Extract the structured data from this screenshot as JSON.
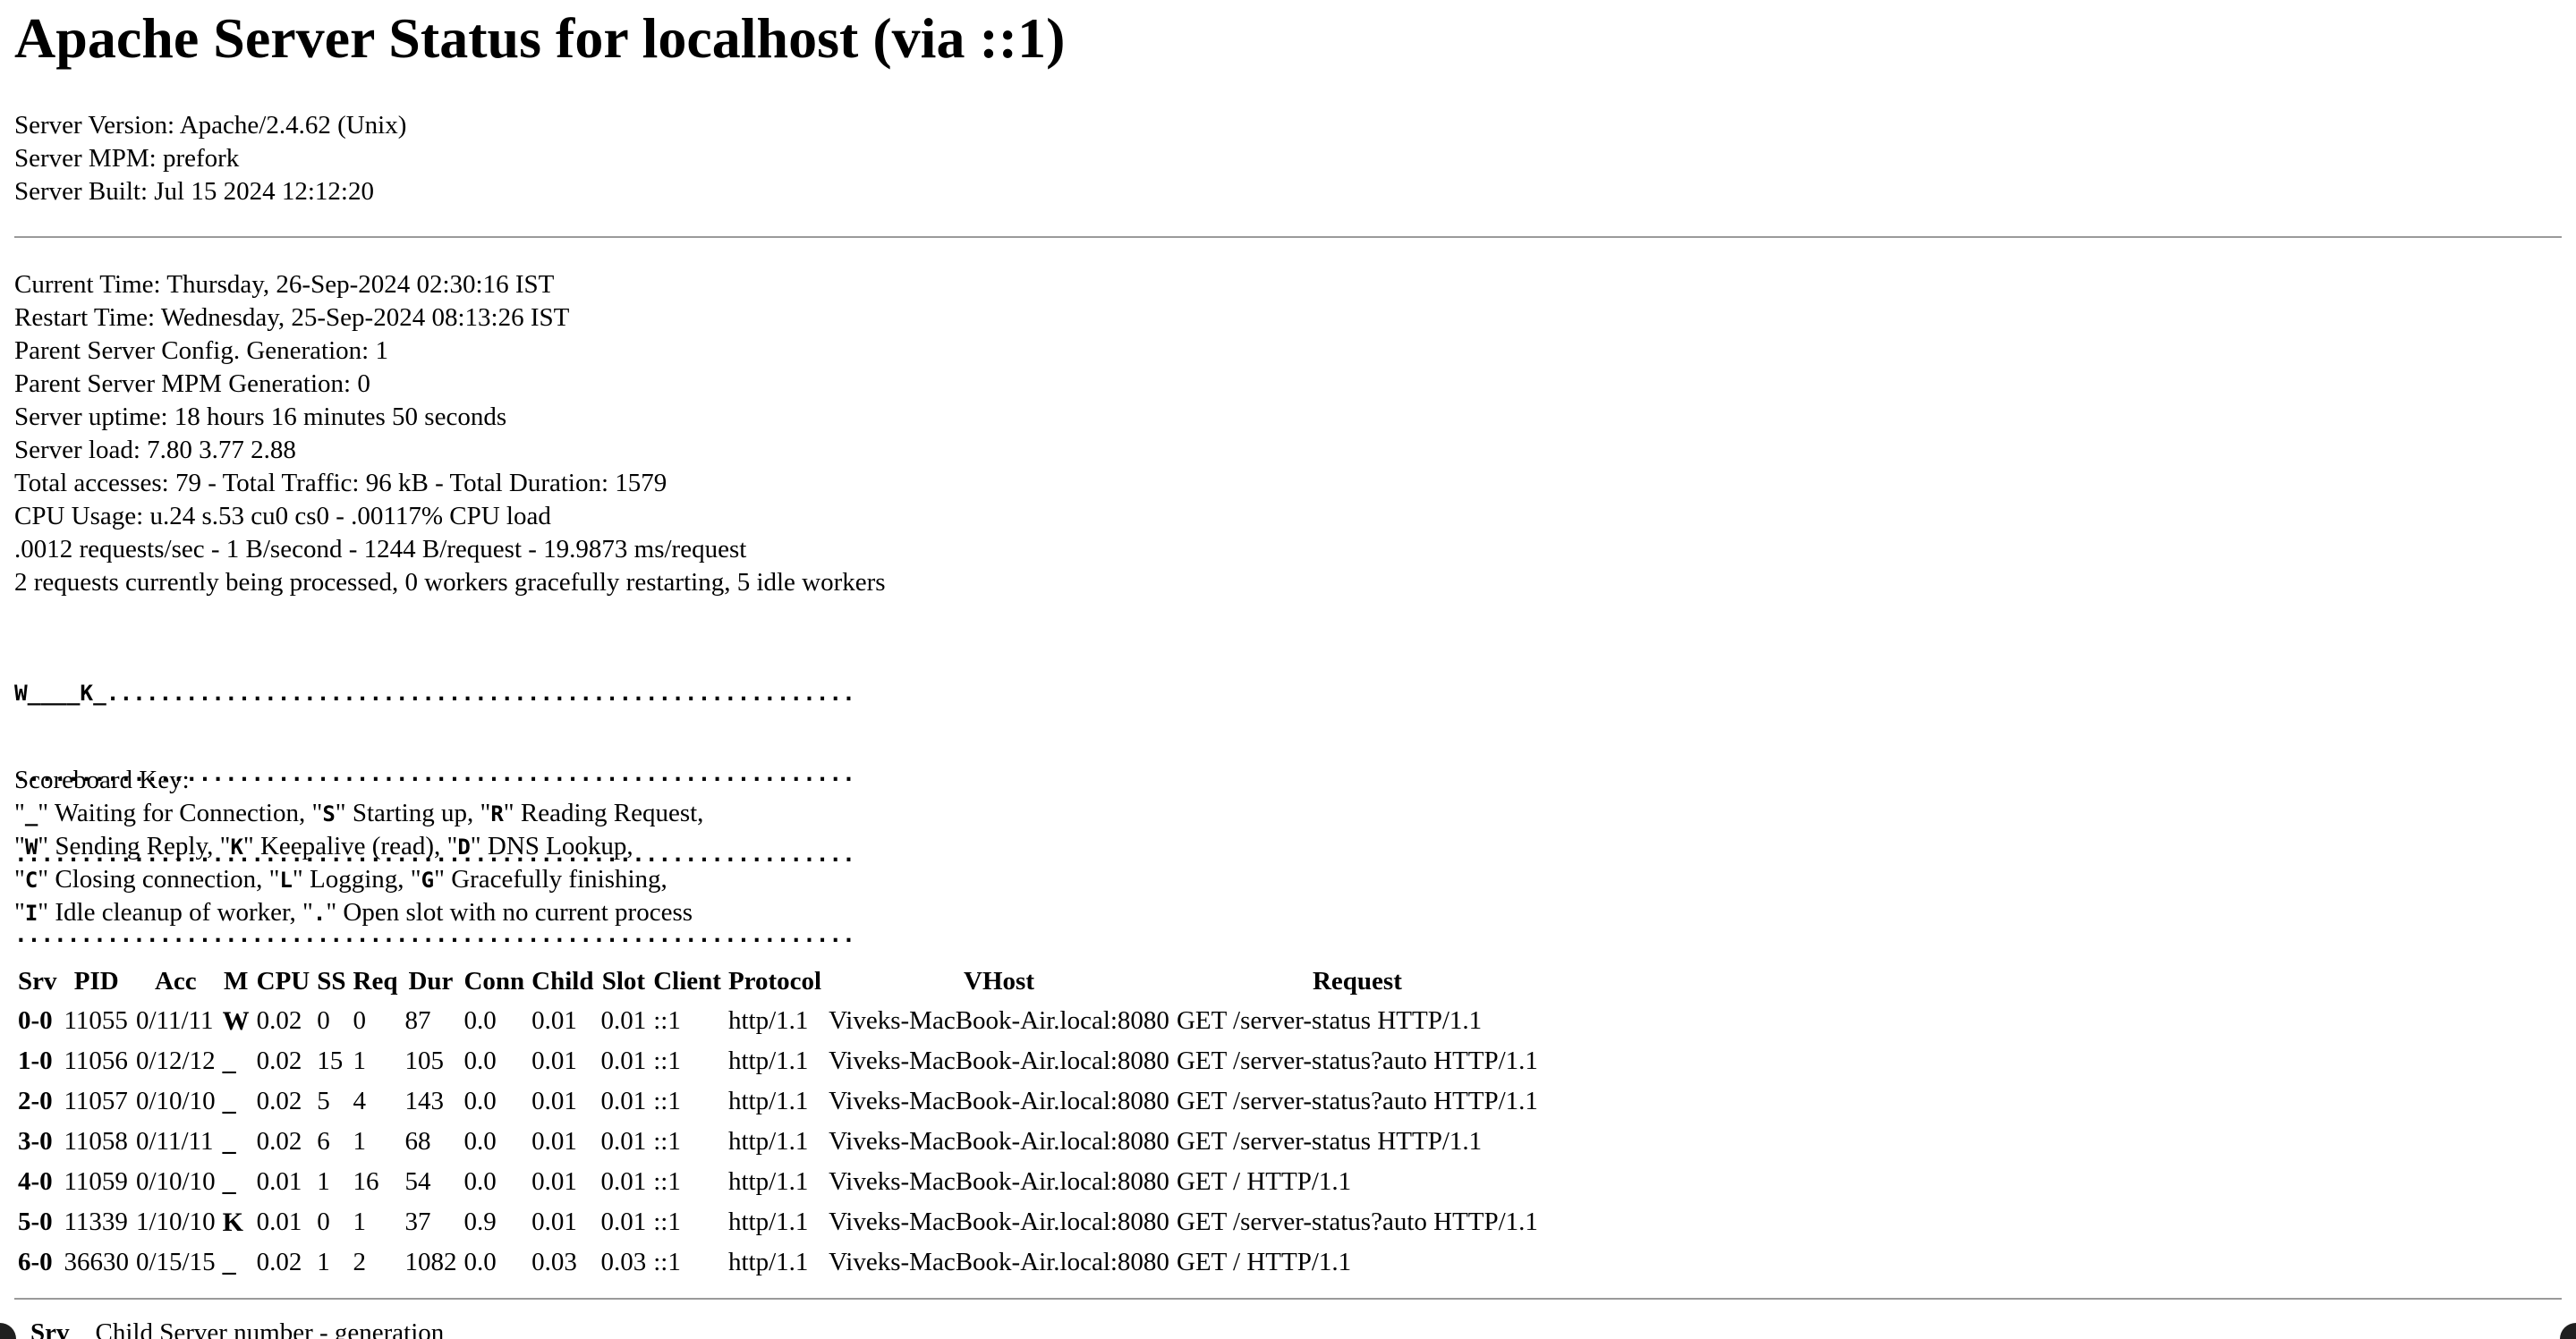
{
  "title": "Apache Server Status for localhost (via ::1)",
  "server_info": [
    "Server Version: Apache/2.4.62 (Unix)",
    "Server MPM: prefork",
    "Server Built: Jul 15 2024 12:12:20"
  ],
  "status_info": [
    "Current Time: Thursday, 26-Sep-2024 02:30:16 IST",
    "Restart Time: Wednesday, 25-Sep-2024 08:13:26 IST",
    "Parent Server Config. Generation: 1",
    "Parent Server MPM Generation: 0",
    "Server uptime: 18 hours 16 minutes 50 seconds",
    "Server load: 7.80 3.77 2.88",
    "Total accesses: 79 - Total Traffic: 96 kB - Total Duration: 1579",
    "CPU Usage: u.24 s.53 cu0 cs0 - .00117% CPU load",
    ".0012 requests/sec - 1 B/second - 1244 B/request - 19.9873 ms/request",
    "2 requests currently being processed, 0 workers gracefully restarting, 5 idle workers"
  ],
  "scoreboard": [
    "W____K_.........................................................",
    "................................................................",
    "................................................................",
    "................................................................"
  ],
  "scoreboard_key": {
    "heading": "Scoreboard Key:",
    "lines": [
      [
        {
          "code": "_",
          "desc": " Waiting for Connection, "
        },
        {
          "code": "S",
          "desc": " Starting up, "
        },
        {
          "code": "R",
          "desc": " Reading Request,"
        }
      ],
      [
        {
          "code": "W",
          "desc": " Sending Reply, "
        },
        {
          "code": "K",
          "desc": " Keepalive (read), "
        },
        {
          "code": "D",
          "desc": " DNS Lookup,"
        }
      ],
      [
        {
          "code": "C",
          "desc": " Closing connection, "
        },
        {
          "code": "L",
          "desc": " Logging, "
        },
        {
          "code": "G",
          "desc": " Gracefully finishing,"
        }
      ],
      [
        {
          "code": "I",
          "desc": " Idle cleanup of worker, "
        },
        {
          "code": ".",
          "desc": " Open slot with no current process"
        }
      ]
    ]
  },
  "workers_table": {
    "headers": [
      "Srv",
      "PID",
      "Acc",
      "M",
      "CPU",
      "SS",
      "Req",
      "Dur",
      "Conn",
      "Child",
      "Slot",
      "Client",
      "Protocol",
      "VHost",
      "Request"
    ],
    "rows": [
      [
        "0-0",
        "11055",
        "0/11/11",
        "W",
        "0.02",
        "0",
        "0",
        "87",
        "0.0",
        "0.01",
        "0.01",
        "::1",
        "http/1.1",
        "Viveks-MacBook-Air.local:8080",
        "GET /server-status HTTP/1.1"
      ],
      [
        "1-0",
        "11056",
        "0/12/12",
        "_",
        "0.02",
        "15",
        "1",
        "105",
        "0.0",
        "0.01",
        "0.01",
        "::1",
        "http/1.1",
        "Viveks-MacBook-Air.local:8080",
        "GET /server-status?auto HTTP/1.1"
      ],
      [
        "2-0",
        "11057",
        "0/10/10",
        "_",
        "0.02",
        "5",
        "4",
        "143",
        "0.0",
        "0.01",
        "0.01",
        "::1",
        "http/1.1",
        "Viveks-MacBook-Air.local:8080",
        "GET /server-status?auto HTTP/1.1"
      ],
      [
        "3-0",
        "11058",
        "0/11/11",
        "_",
        "0.02",
        "6",
        "1",
        "68",
        "0.0",
        "0.01",
        "0.01",
        "::1",
        "http/1.1",
        "Viveks-MacBook-Air.local:8080",
        "GET /server-status HTTP/1.1"
      ],
      [
        "4-0",
        "11059",
        "0/10/10",
        "_",
        "0.01",
        "1",
        "16",
        "54",
        "0.0",
        "0.01",
        "0.01",
        "::1",
        "http/1.1",
        "Viveks-MacBook-Air.local:8080",
        "GET / HTTP/1.1"
      ],
      [
        "5-0",
        "11339",
        "1/10/10",
        "K",
        "0.01",
        "0",
        "1",
        "37",
        "0.9",
        "0.01",
        "0.01",
        "::1",
        "http/1.1",
        "Viveks-MacBook-Air.local:8080",
        "GET /server-status?auto HTTP/1.1"
      ],
      [
        "6-0",
        "36630",
        "0/15/15",
        "_",
        "0.02",
        "1",
        "2",
        "1082",
        "0.0",
        "0.03",
        "0.03",
        "::1",
        "http/1.1",
        "Viveks-MacBook-Air.local:8080",
        "GET / HTTP/1.1"
      ]
    ]
  },
  "legend_first": {
    "term": "Srv",
    "desc": "Child Server number - generation"
  }
}
